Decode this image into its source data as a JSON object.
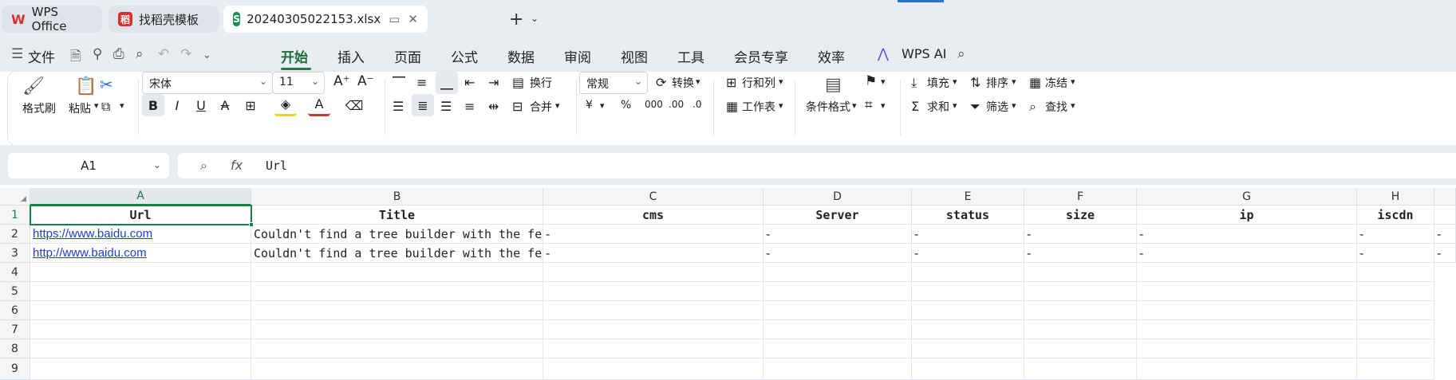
{
  "tabs": [
    {
      "label": "WPS Office",
      "icon": "wps-logo-icon"
    },
    {
      "label": "找稻壳模板",
      "icon": "docer-icon"
    },
    {
      "label": "20240305022153.xlsx",
      "icon": "spreadsheet-s-icon"
    }
  ],
  "menu": {
    "file": "文件",
    "items": [
      "开始",
      "插入",
      "页面",
      "公式",
      "数据",
      "审阅",
      "视图",
      "工具",
      "会员专享",
      "效率"
    ],
    "active": "开始",
    "wps_ai": "WPS AI"
  },
  "ribbon": {
    "format_painter": "格式刷",
    "paste": "粘贴",
    "font_name": "宋体",
    "font_size": "11",
    "wrap": "换行",
    "merge": "合并",
    "number_format": "常规",
    "convert": "转换",
    "row_col": "行和列",
    "worksheet": "工作表",
    "cond_format": "条件格式",
    "fill": "填充",
    "sort": "排序",
    "freeze": "冻结",
    "sum": "求和",
    "filter": "筛选",
    "find": "查找",
    "currency": "¥",
    "percent": "%"
  },
  "formula_bar": {
    "cell_ref": "A1",
    "fx": "fx",
    "value": "Url"
  },
  "sheet": {
    "columns": [
      "A",
      "B",
      "C",
      "D",
      "E",
      "F",
      "G",
      "H"
    ],
    "row_numbers": [
      "1",
      "2",
      "3",
      "4",
      "5",
      "6",
      "7",
      "8",
      "9"
    ],
    "header": [
      "Url",
      "Title",
      "cms",
      "Server",
      "status",
      "size",
      "ip",
      "iscdn"
    ],
    "rows": [
      [
        "https://www.baidu.com",
        "Couldn't find a tree builder with the fe",
        "-",
        "-",
        "-",
        "-",
        "-",
        "-",
        "-"
      ],
      [
        "http://www.baidu.com",
        "Couldn't find a tree builder with the fe",
        "-",
        "-",
        "-",
        "-",
        "-",
        "-",
        "-"
      ]
    ]
  },
  "colors": {
    "accent": "#1a7f47",
    "link": "#1f3fd0"
  }
}
